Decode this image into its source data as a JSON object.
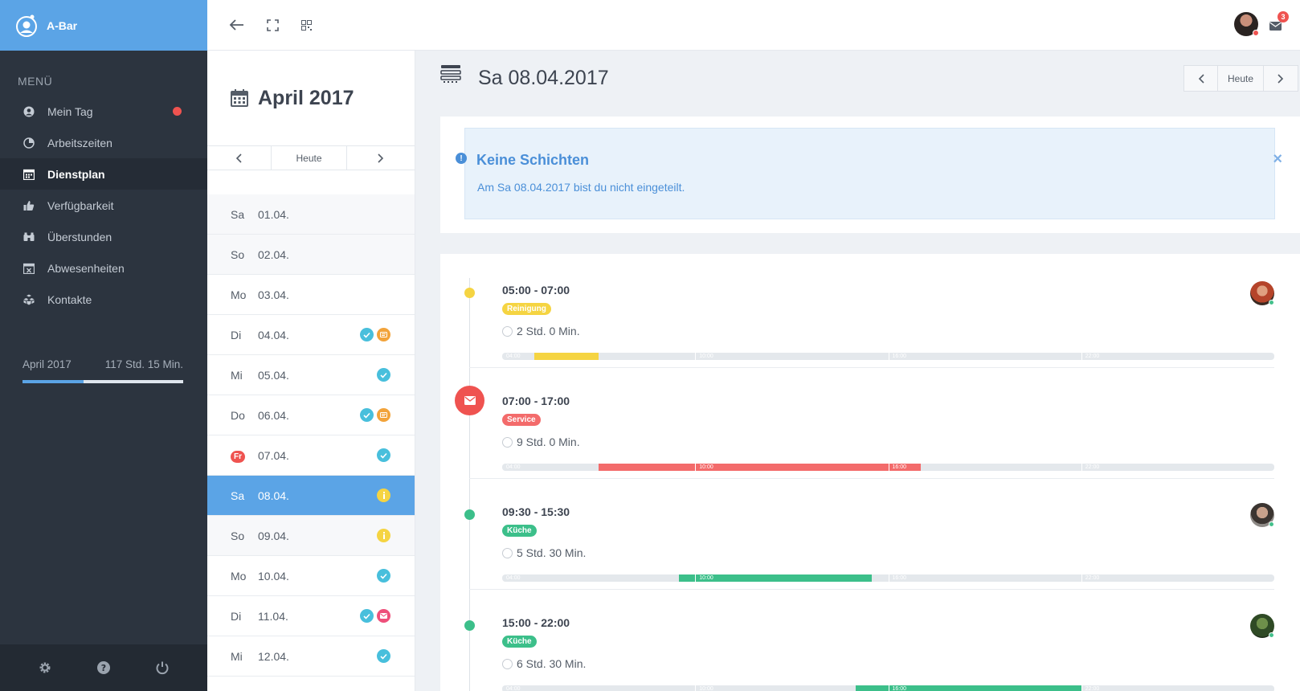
{
  "brand": {
    "name": "A-Bar"
  },
  "sidebar": {
    "menu_title": "MENÜ",
    "items": [
      {
        "label": "Mein Tag",
        "icon": "user-circle-icon",
        "badge": true
      },
      {
        "label": "Arbeitszeiten",
        "icon": "clock-pie-icon"
      },
      {
        "label": "Dienstplan",
        "icon": "calendar-icon",
        "active": true
      },
      {
        "label": "Verfügbarkeit",
        "icon": "thumbs-up-icon"
      },
      {
        "label": "Überstunden",
        "icon": "binoculars-icon"
      },
      {
        "label": "Abwesenheiten",
        "icon": "calendar-x-icon"
      },
      {
        "label": "Kontakte",
        "icon": "cubes-icon"
      }
    ],
    "stats": {
      "month": "April 2017",
      "hours": "117 Std. 15 Min.",
      "progress": 0.38
    },
    "footer": {
      "icons": [
        "gear-icon",
        "help-icon",
        "power-icon"
      ]
    }
  },
  "topbar": {
    "icons": [
      "back-arrow-icon",
      "fullscreen-icon",
      "qr-code-icon"
    ],
    "mail_badge": "3"
  },
  "calendar": {
    "title": "April 2017",
    "today_label": "Heute",
    "days": [
      {
        "name": "Sa",
        "date": "01.04.",
        "weekend": true,
        "icons": []
      },
      {
        "name": "So",
        "date": "02.04.",
        "weekend": true,
        "icons": []
      },
      {
        "name": "Mo",
        "date": "03.04.",
        "icons": []
      },
      {
        "name": "Di",
        "date": "04.04.",
        "icons": [
          "check",
          "chat"
        ]
      },
      {
        "name": "Mi",
        "date": "05.04.",
        "icons": [
          "check"
        ]
      },
      {
        "name": "Do",
        "date": "06.04.",
        "icons": [
          "check",
          "chat"
        ]
      },
      {
        "name": "Fr",
        "date": "07.04.",
        "holiday": true,
        "icons": [
          "check"
        ]
      },
      {
        "name": "Sa",
        "date": "08.04.",
        "weekend": true,
        "selected": true,
        "icons": [
          "info"
        ]
      },
      {
        "name": "So",
        "date": "09.04.",
        "weekend": true,
        "icons": [
          "info"
        ]
      },
      {
        "name": "Mo",
        "date": "10.04.",
        "icons": [
          "check"
        ]
      },
      {
        "name": "Di",
        "date": "11.04.",
        "icons": [
          "check",
          "mail"
        ]
      },
      {
        "name": "Mi",
        "date": "12.04.",
        "icons": [
          "check"
        ]
      }
    ]
  },
  "main": {
    "title": "Sa 08.04.2017",
    "today_label": "Heute",
    "alert": {
      "title": "Keine Schichten",
      "text": "Am Sa 08.04.2017 bist du nicht eingeteilt."
    }
  },
  "shifts": [
    {
      "time": "05:00 - 07:00",
      "tag": "Reinigung",
      "color": "#f5d442",
      "duration": "2 Std. 0 Min.",
      "start": 5.0,
      "end": 7.0,
      "avatar": "avatar-woman-red-hair"
    },
    {
      "time": "07:00 - 17:00",
      "tag": "Service",
      "color": "#f36b6b",
      "duration": "9 Std. 0 Min.",
      "start": 7.0,
      "end": 17.0,
      "mail": true
    },
    {
      "time": "09:30 - 15:30",
      "tag": "Küche",
      "color": "#3cbf8a",
      "duration": "5 Std. 30 Min.",
      "start": 9.5,
      "end": 15.5,
      "avatar": "avatar-man-beard"
    },
    {
      "time": "15:00 - 22:00",
      "tag": "Küche",
      "color": "#3cbf8a",
      "duration": "6 Std. 30 Min.",
      "start": 15.0,
      "end": 22.0,
      "avatar": "avatar-man-green"
    }
  ],
  "bar_scale": {
    "start": 4,
    "end": 28,
    "ticks": [
      "04:00",
      "10:00",
      "16:00",
      "22:00"
    ],
    "tick_hours": [
      4,
      10,
      16,
      22
    ]
  },
  "colors": {
    "accent": "#5ba4e6",
    "sidebar": "#2c343f",
    "check": "#48bfdc",
    "chat": "#f2a33a",
    "info": "#f5d442",
    "mail": "#ee4f7a"
  }
}
